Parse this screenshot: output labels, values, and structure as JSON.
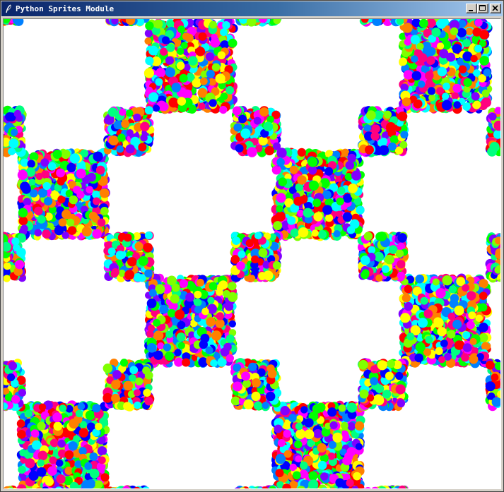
{
  "window": {
    "title": "Python Sprites Module",
    "title_icon": "feather-icon",
    "buttons": {
      "minimize_icon": "minimize-icon",
      "maximize_icon": "maximize-icon",
      "close_icon": "close-icon"
    }
  },
  "scene": {
    "background_color": "#ffffff",
    "sprite_shape": "circle",
    "sprite_colors": [
      "#ff0000",
      "#ff00ff",
      "#0000ff",
      "#00ffff",
      "#00ff00",
      "#ffff00",
      "#ff8000",
      "#8000ff",
      "#00ff80",
      "#ff0080",
      "#80ff00",
      "#0080ff"
    ],
    "pattern": "checkerboard of dense sprite clusters"
  }
}
